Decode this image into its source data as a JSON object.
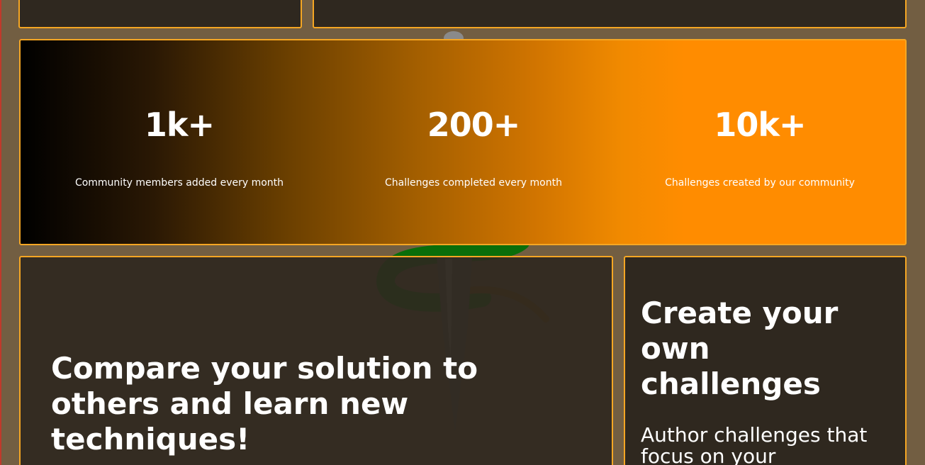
{
  "stats": [
    {
      "value": "1k+",
      "label": "Community members added every month"
    },
    {
      "value": "200+",
      "label": "Challenges completed every month"
    },
    {
      "value": "10k+",
      "label": "Challenges created by our community"
    }
  ],
  "compare": {
    "title": "Compare your solution to others and learn new techniques!"
  },
  "create": {
    "title": "Create your own challenges",
    "subtitle": "Author challenges that focus on your"
  },
  "colors": {
    "background": "#725e42",
    "card": "#2f281f",
    "accent": "#f5a623",
    "gradient_end": "#ff8c00"
  }
}
